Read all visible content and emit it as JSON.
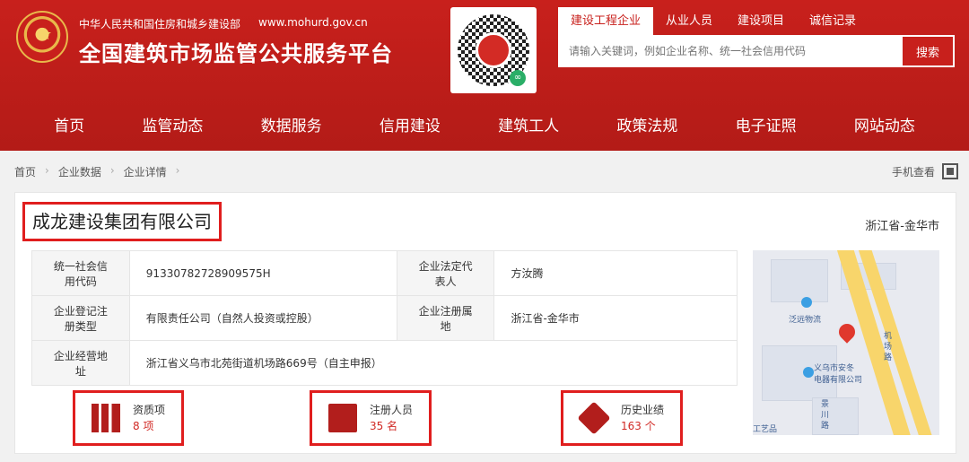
{
  "header": {
    "subtitle": "中华人民共和国住房和城乡建设部",
    "domain": "www.mohurd.gov.cn",
    "title": "全国建筑市场监管公共服务平台"
  },
  "search": {
    "tabs": [
      "建设工程企业",
      "从业人员",
      "建设项目",
      "诚信记录"
    ],
    "placeholder": "请输入关键词，例如企业名称、统一社会信用代码",
    "button": "搜索"
  },
  "nav": [
    "首页",
    "监管动态",
    "数据服务",
    "信用建设",
    "建筑工人",
    "政策法规",
    "电子证照",
    "网站动态"
  ],
  "breadcrumb": [
    "首页",
    "企业数据",
    "企业详情"
  ],
  "mobile_view": "手机查看",
  "company": {
    "name": "成龙建设集团有限公司",
    "region": "浙江省-金华市"
  },
  "info": {
    "credit_code_label": "统一社会信用代码",
    "credit_code": "91330782728909575H",
    "legal_rep_label": "企业法定代表人",
    "legal_rep": "方汝腾",
    "type_label": "企业登记注册类型",
    "type": "有限责任公司（自然人投资或控股）",
    "registered_place_label": "企业注册属地",
    "registered_place": "浙江省-金华市",
    "address_label": "企业经营地址",
    "address": "浙江省义乌市北苑街道机场路669号（自主申报）"
  },
  "map": {
    "labels": [
      "泛远物流",
      "义乌市安冬\n电器有限公司",
      "机场路",
      "景川路",
      "工艺品"
    ]
  },
  "stats": [
    {
      "label": "资质项",
      "count": "8 项"
    },
    {
      "label": "注册人员",
      "count": "35 名"
    },
    {
      "label": "历史业绩",
      "count": "163 个"
    }
  ],
  "colors": {
    "brand": "#c8201c",
    "highlight": "#e01e1e"
  }
}
